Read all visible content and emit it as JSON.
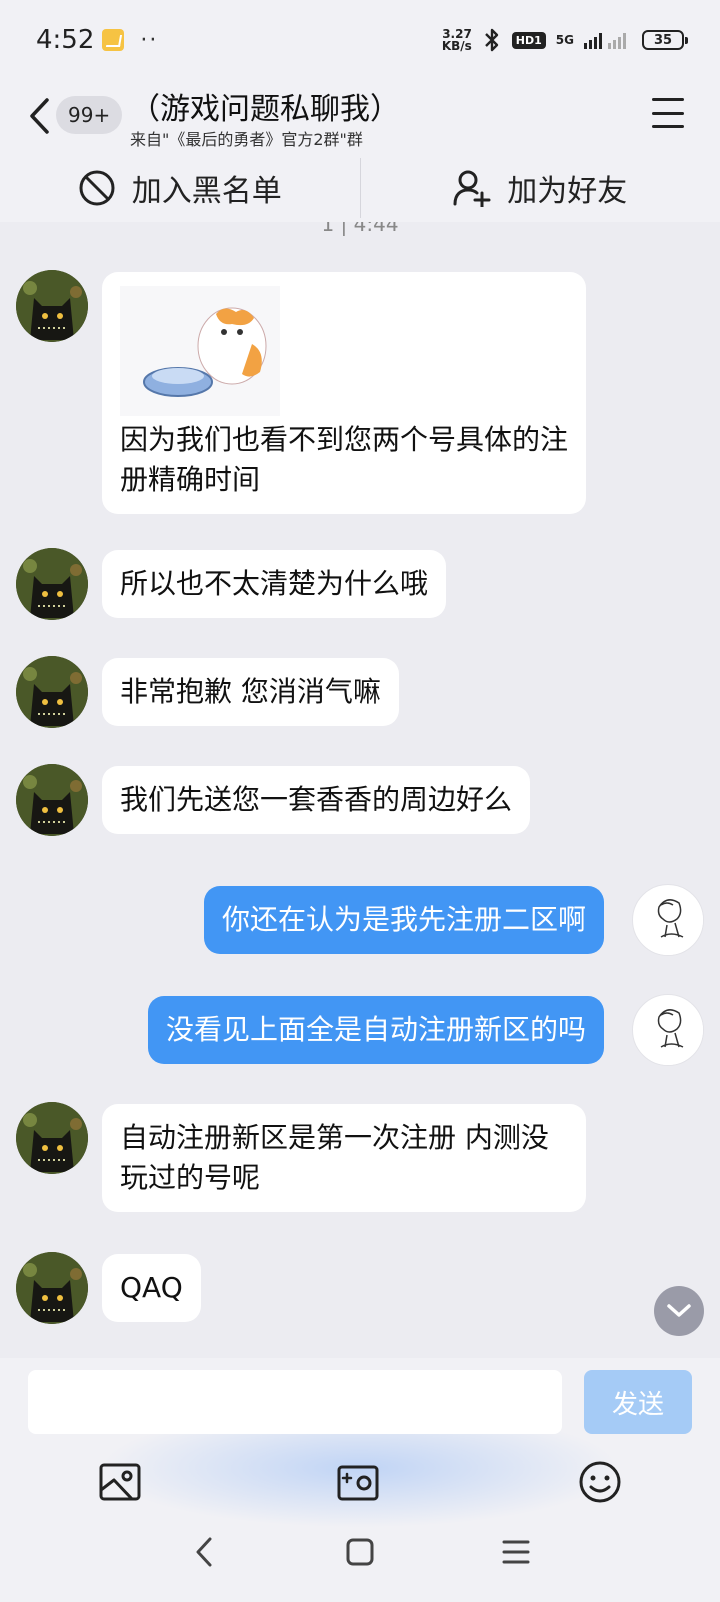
{
  "status_bar": {
    "time": "4:52",
    "dots": "··",
    "net_speed_value": "3.27",
    "net_speed_unit": "KB/s",
    "hd_label": "HD1",
    "network_label": "5G",
    "battery": "35"
  },
  "header": {
    "back_icon": "chevron-left-icon",
    "unread_count": "99+",
    "title": "（游戏问题私聊我）",
    "subtitle": "来自\"《最后的勇者》官方2群\"群",
    "menu_icon": "hamburger-icon"
  },
  "actions": {
    "block_label": "加入黑名单",
    "block_icon": "block-icon",
    "add_friend_label": "加为好友",
    "add_friend_icon": "add-user-icon"
  },
  "chat": {
    "partial_timestamp": "1 | 4:44",
    "messages": [
      {
        "side": "left",
        "has_sticker": true,
        "sticker": "cat-with-bowl-sticker",
        "text": "因为我们也看不到您两个号具体的注册精确时间"
      },
      {
        "side": "left",
        "text": "所以也不太清楚为什么哦"
      },
      {
        "side": "left",
        "text": "非常抱歉 您消消气嘛"
      },
      {
        "side": "left",
        "text": "我们先送您一套香香的周边好么"
      },
      {
        "side": "right",
        "text": "你还在认为是我先注册二区啊"
      },
      {
        "side": "right",
        "text": "没看见上面全是自动注册新区的吗"
      },
      {
        "side": "left",
        "text": "自动注册新区是第一次注册 内测没玩过的号呢"
      },
      {
        "side": "left",
        "text": "QAQ"
      }
    ]
  },
  "composer": {
    "input_value": "",
    "send_label": "发送",
    "tools": [
      "image-icon",
      "camera-icon",
      "emoji-icon"
    ]
  },
  "nav": {
    "icons": [
      "back-nav-icon",
      "home-nav-icon",
      "recents-nav-icon"
    ]
  },
  "colors": {
    "outgoing_bubble": "#4296f4",
    "incoming_bubble": "#ffffff",
    "background": "#ececf1",
    "send_button": "#a5cbf6"
  }
}
